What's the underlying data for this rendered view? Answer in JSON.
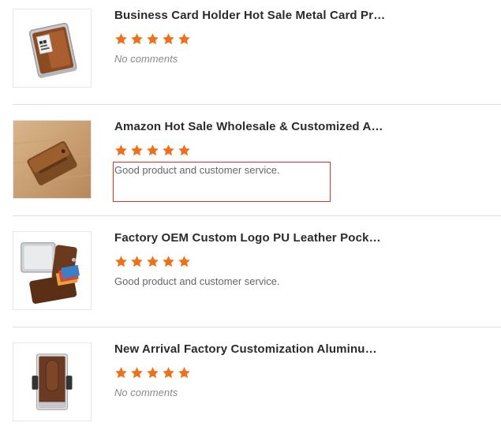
{
  "colors": {
    "star": "#f0701a",
    "title": "#2b2b2b",
    "comment": "#666666",
    "highlight": "#d8342c",
    "divider": "#dedede"
  },
  "reviews": [
    {
      "title": "Business Card Holder Hot Sale Metal Card Prot...",
      "rating": 5,
      "comment": "No comments",
      "has_comment": false,
      "image_icon": "card-holder-metal-image"
    },
    {
      "title": "Amazon Hot Sale Wholesale & Customized Aut...",
      "rating": 5,
      "comment": "Good product and customer service.",
      "has_comment": true,
      "image_icon": "leather-wallet-image"
    },
    {
      "title": "Factory OEM Custom Logo PU Leather Pocket ...",
      "rating": 5,
      "comment": "Good product and customer service.",
      "has_comment": true,
      "image_icon": "pop-up-wallet-image"
    },
    {
      "title": "New Arrival Factory Customization Aluminum ...",
      "rating": 5,
      "comment": "No comments",
      "has_comment": false,
      "image_icon": "aluminum-card-holder-image"
    }
  ]
}
